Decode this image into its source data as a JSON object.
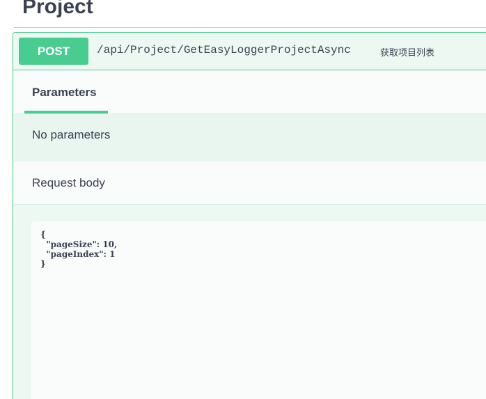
{
  "section": {
    "title": "Project"
  },
  "operation": {
    "method": "POST",
    "path": "/api/Project/GetEasyLoggerProjectAsync",
    "description": "获取项目列表"
  },
  "tabs": {
    "parameters_label": "Parameters"
  },
  "parameters": {
    "empty_text": "No parameters"
  },
  "request_body": {
    "label": "Request body",
    "code_lines": [
      "{",
      "  \"pageSize\": 10,",
      "  \"pageIndex\": 1",
      "}"
    ]
  },
  "colors": {
    "post_green": "#49cc90",
    "block_bg": "#edf8f3",
    "text": "#3b4151"
  }
}
